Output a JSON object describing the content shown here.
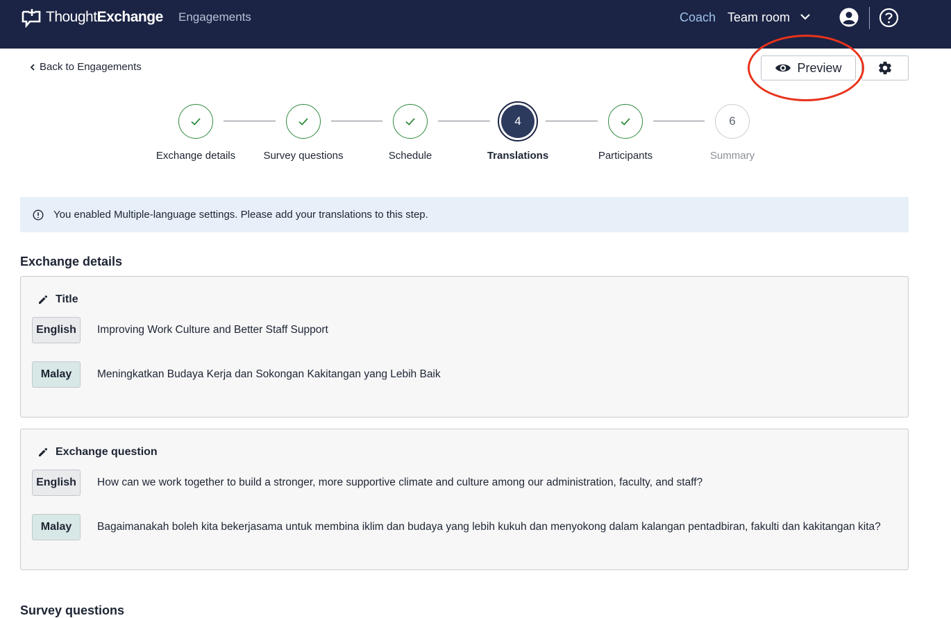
{
  "header": {
    "logo_light": "Thought",
    "logo_bold": "Exchange",
    "nav_engagements": "Engagements",
    "nav_coach": "Coach",
    "nav_team_room": "Team room"
  },
  "toolbar": {
    "back_label": "Back to Engagements",
    "preview_label": "Preview"
  },
  "steps": [
    {
      "label": "Exchange details",
      "state": "done"
    },
    {
      "label": "Survey questions",
      "state": "done"
    },
    {
      "label": "Schedule",
      "state": "done"
    },
    {
      "label": "Translations",
      "number": "4",
      "state": "current"
    },
    {
      "label": "Participants",
      "state": "done"
    },
    {
      "label": "Summary",
      "number": "6",
      "state": "todo"
    }
  ],
  "alert": {
    "text": "You enabled Multiple-language settings. Please add your translations to this step."
  },
  "sections": {
    "exchange_details": "Exchange details",
    "survey_questions": "Survey questions"
  },
  "cards": {
    "title": {
      "heading": "Title",
      "english_tag": "English",
      "english_text": "Improving Work Culture and Better Staff Support",
      "malay_tag": "Malay",
      "malay_text": "Meningkatkan Budaya Kerja dan Sokongan Kakitangan yang Lebih Baik"
    },
    "question": {
      "heading": "Exchange question",
      "english_tag": "English",
      "english_text": "How can we work together to build a stronger, more supportive climate and culture among our administration, faculty, and staff?",
      "malay_tag": "Malay",
      "malay_text": "Bagaimanakah boleh kita bekerjasama untuk membina iklim dan budaya yang lebih kukuh dan menyokong dalam kalangan pentadbiran, fakulti dan kakitangan kita?"
    }
  },
  "colors": {
    "header_bg": "#1b2445",
    "done_green": "#2e8a3e",
    "current_step": "#2c3a5e",
    "alert_bg": "#e7f0f8",
    "highlight": "#e8331c"
  }
}
